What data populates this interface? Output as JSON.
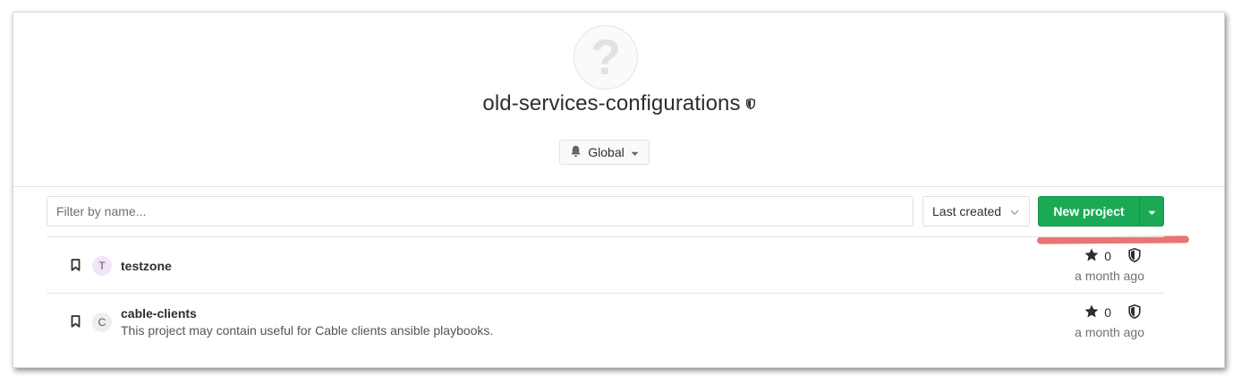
{
  "group": {
    "avatar_glyph": "?",
    "name": "old-services-configurations",
    "visibility_icon": "shield-icon"
  },
  "notifications": {
    "label": "Global",
    "icon": "bell-icon"
  },
  "toolbar": {
    "filter_placeholder": "Filter by name...",
    "sort_label": "Last created",
    "new_project_label": "New project",
    "accent_color": "#1aaa55"
  },
  "projects": [
    {
      "initial": "T",
      "name": "testzone",
      "description": "",
      "stars": "0",
      "updated": "a month ago",
      "avatar_color": "#f1e5f9"
    },
    {
      "initial": "C",
      "name": "cable-clients",
      "description": "This project may contain useful for Cable clients ansible playbooks.",
      "stars": "0",
      "updated": "a month ago",
      "avatar_color": "#eeeeee"
    }
  ]
}
